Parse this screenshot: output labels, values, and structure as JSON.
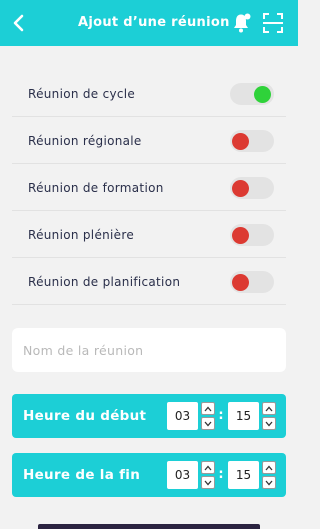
{
  "header": {
    "title": "Ajout d’une réunion",
    "back_icon": "chevron-left-icon",
    "bell_icon": "bell-icon",
    "scan_icon": "scan-icon"
  },
  "colors": {
    "accent": "#1ccfd6",
    "toggle_on": "#2fd23a",
    "toggle_off": "#dc3a32",
    "track": "#e3e3e3",
    "background": "#f2f2f2"
  },
  "meeting_types": [
    {
      "label": "Réunion de cycle",
      "enabled": true
    },
    {
      "label": "Réunion régionale",
      "enabled": false
    },
    {
      "label": "Réunion de formation",
      "enabled": false
    },
    {
      "label": "Réunion plénière",
      "enabled": false
    },
    {
      "label": "Réunion de planification",
      "enabled": false
    }
  ],
  "name_field": {
    "placeholder": "Nom de la réunion",
    "value": ""
  },
  "start_time": {
    "label": "Heure du début",
    "hours": "03",
    "minutes": "15",
    "separator": ":"
  },
  "end_time": {
    "label": "Heure de la fin",
    "hours": "03",
    "minutes": "15",
    "separator": ":"
  }
}
